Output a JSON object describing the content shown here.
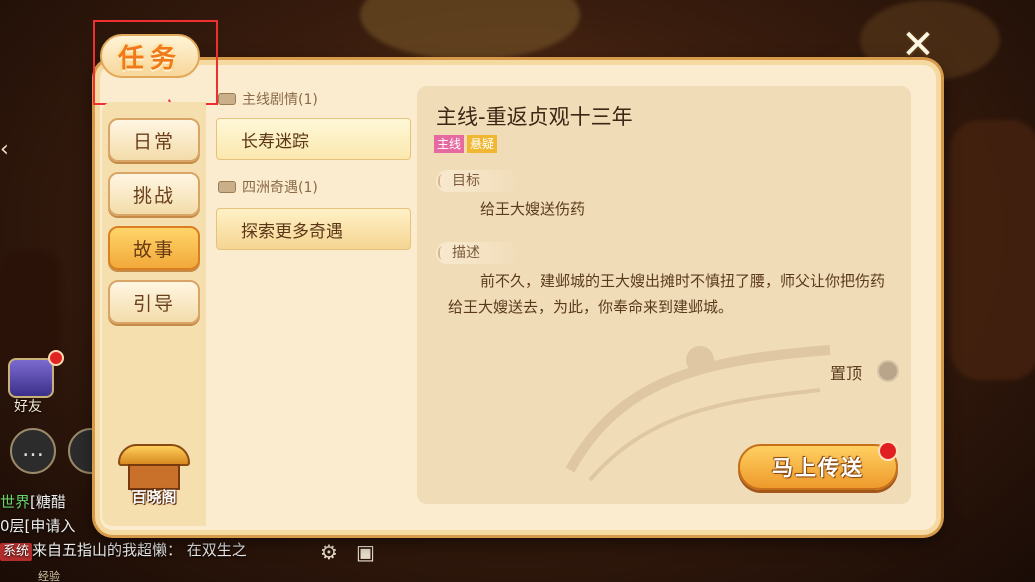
{
  "window": {
    "title": "任务",
    "close_symbol": "✕"
  },
  "tabs": [
    {
      "label": "日常",
      "active": false
    },
    {
      "label": "挑战",
      "active": false
    },
    {
      "label": "故事",
      "active": true
    },
    {
      "label": "引导",
      "active": false
    }
  ],
  "pavilion": {
    "label": "百晓阁",
    "icon": "pavilion-icon"
  },
  "quest_groups": [
    {
      "header": "主线剧情(1)",
      "items": [
        "长寿迷踪"
      ]
    },
    {
      "header": "四洲奇遇(1)",
      "items": [
        "探索更多奇遇"
      ]
    }
  ],
  "detail": {
    "title": "主线-重返贞观十三年",
    "badges": [
      "主线",
      "悬疑"
    ],
    "goal_label": "目标",
    "goal_text": "给王大嫂送伤药",
    "desc_label": "描述",
    "desc_text": "前不久，建邺城的王大嫂出摊时不慎扭了腰，师父让你把伤药给王大嫂送去，为此，你奉命来到建邺城。",
    "pin_label": "置顶",
    "action_label": "马上传送"
  },
  "hud": {
    "friend_label": "好友",
    "chat": [
      {
        "tag": "世界",
        "text": "[糖醋"
      },
      {
        "tag": "",
        "text": "0层[申请入"
      },
      {
        "tag": "系统",
        "text": "来自五指山的我超懒： 在双生之"
      }
    ],
    "exp_label": "经验"
  },
  "colors": {
    "accent": "#f07a1a",
    "active_tab": "#f2a93a",
    "annotation": "#ee3030",
    "badge_main": "#e46aa0",
    "badge_mystery": "#f0b832"
  }
}
